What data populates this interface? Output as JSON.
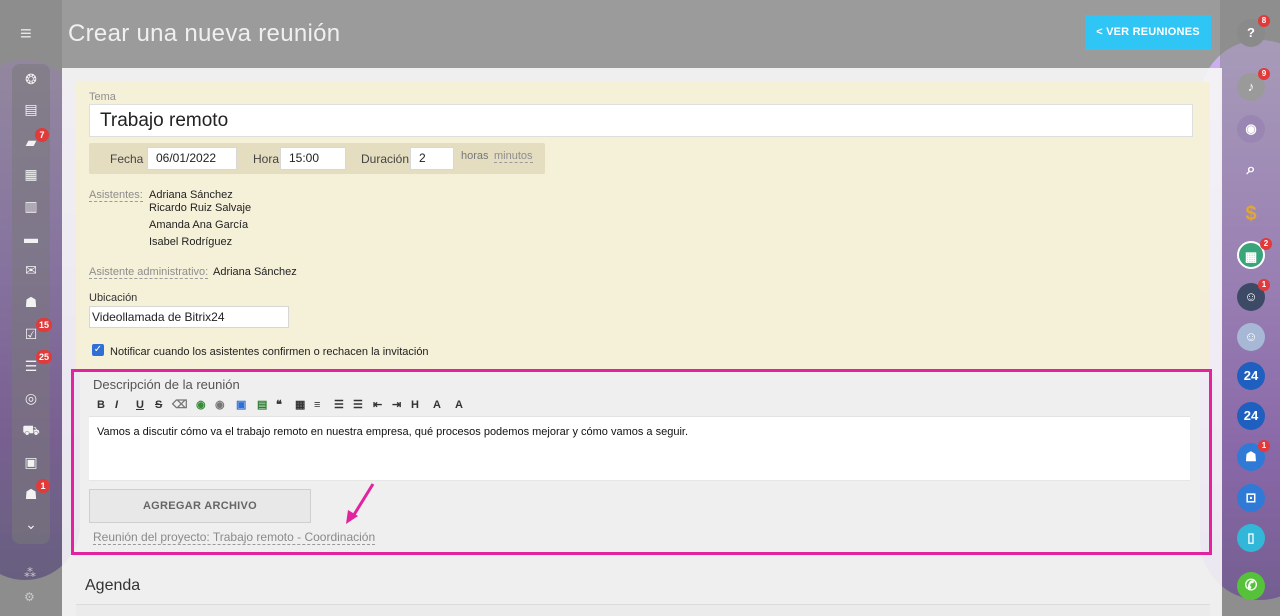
{
  "header": {
    "title": "Crear una nueva reunión",
    "ver_button": "< VER REUNIONES"
  },
  "left_sidebar": {
    "badges": {
      "chat": "7",
      "tasks": "15",
      "filters": "25",
      "robot": "1"
    }
  },
  "right_sidebar": {
    "badges": {
      "help": "8",
      "notifications": "9",
      "calendar": "2",
      "group": "1",
      "contacts": "1"
    },
    "labels": {
      "b24_1": "24",
      "b24_2": "24"
    }
  },
  "form": {
    "tema_label": "Tema",
    "tema_value": "Trabajo remoto",
    "fecha_label": "Fecha",
    "fecha_value": "06/01/2022",
    "hora_label": "Hora",
    "hora_value": "15:00",
    "duracion_label": "Duración",
    "duracion_value": "2",
    "horas_label": "horas",
    "minutos_label": "minutos",
    "asistentes_label": "Asistentes:",
    "asistentes": [
      "Adriana Sánchez",
      "Ricardo Ruiz Salvaje",
      "Amanda Ana García",
      "Isabel Rodríguez"
    ],
    "admin_label": "Asistente administrativo:",
    "admin_value": "Adriana Sánchez",
    "ubicacion_label": "Ubicación",
    "ubicacion_value": "Videollamada de Bitrix24",
    "notify_label": "Notificar cuando los asistentes confirmen o rechacen la invitación",
    "notify_checked": true
  },
  "description": {
    "title": "Descripción de la reunión",
    "text": "Vamos a discutir cómo va el trabajo remoto en nuestra empresa, qué procesos podemos mejorar y cómo vamos a seguir.",
    "add_file_button": "AGREGAR ARCHIVO",
    "project_link": "Reunión del proyecto: Trabajo remoto - Coordinación"
  },
  "agenda": {
    "title": "Agenda"
  },
  "colors": {
    "accent": "#2fc6f6",
    "highlight": "#e3229f",
    "badge": "#e03a3a"
  }
}
